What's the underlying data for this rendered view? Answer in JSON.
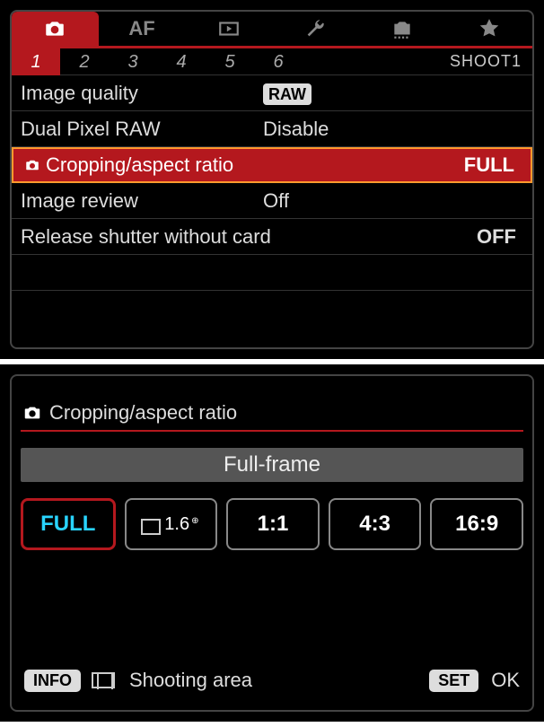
{
  "top": {
    "tabs": [
      "camera",
      "af",
      "playback",
      "wrench",
      "custom",
      "star"
    ],
    "active_tab_index": 0,
    "subtabs": [
      "1",
      "2",
      "3",
      "4",
      "5",
      "6"
    ],
    "active_subtab_index": 0,
    "subtab_group_label": "SHOOT1",
    "rows": [
      {
        "label": "Image quality",
        "value": "RAW",
        "badge": true
      },
      {
        "label": "Dual Pixel RAW",
        "value": "Disable"
      },
      {
        "label": "Cropping/aspect ratio",
        "value": "FULL",
        "selected": true,
        "icon": "camera",
        "align": "right"
      },
      {
        "label": "Image review",
        "value": "Off"
      },
      {
        "label": "Release shutter without card",
        "value": "OFF",
        "align": "right"
      }
    ]
  },
  "bottom": {
    "title": "Cropping/aspect ratio",
    "current": "Full-frame",
    "options": [
      "FULL",
      "1.6x",
      "1:1",
      "4:3",
      "16:9"
    ],
    "active_option_index": 0,
    "footer": {
      "info_label": "INFO",
      "shooting_area": "Shooting area",
      "set_label": "SET",
      "ok_label": "OK"
    }
  }
}
